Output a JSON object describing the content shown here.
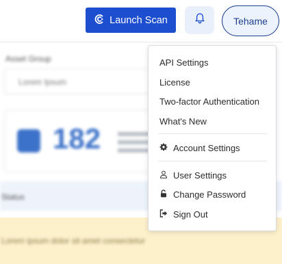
{
  "header": {
    "launch_scan_label": "Launch Scan",
    "user_button_label": "Tehame"
  },
  "background": {
    "field_label": "Asset Group",
    "field_value": "Lorem Ipsum",
    "stat_number": "182",
    "strip_text": "Status",
    "banner_text": "Lorem ipsum dolor sit amet consectetur"
  },
  "menu": {
    "items": [
      {
        "label": "API Settings"
      },
      {
        "label": "License"
      },
      {
        "label": "Two-factor Authentication"
      },
      {
        "label": "What's New"
      },
      {
        "label": "Account Settings",
        "icon": "gear-icon"
      },
      {
        "label": "User Settings",
        "icon": "user-icon"
      },
      {
        "label": "Change Password",
        "icon": "unlock-icon"
      },
      {
        "label": "Sign Out",
        "icon": "sign-out-icon"
      }
    ]
  },
  "colors": {
    "primary": "#1d4ed0",
    "user_border": "#1d3f8f",
    "banner": "#fdf1cc"
  }
}
